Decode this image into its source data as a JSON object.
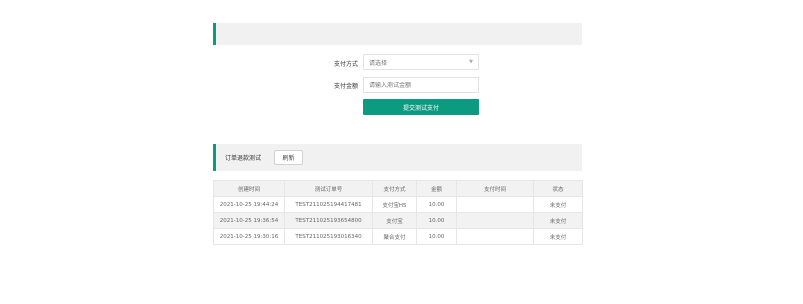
{
  "pay_form": {
    "method_label": "支付方式",
    "method_value": "请选择",
    "amount_label": "支付金额",
    "amount_placeholder": "请输入测试金额",
    "submit_label": "提交测试支付"
  },
  "order_section": {
    "title": "订单退款测试",
    "refresh_label": "刷新"
  },
  "table": {
    "headers": [
      "创建时间",
      "测试订单号",
      "支付方式",
      "金额",
      "支付时间",
      "状态"
    ],
    "rows": [
      [
        "2021-10-25 19:44:24",
        "TEST211025194417481",
        "支付宝H5",
        "10.00",
        "",
        "未支付"
      ],
      [
        "2021-10-25 19:36:54",
        "TEST211025193654800",
        "支付宝",
        "10.00",
        "",
        "未支付"
      ],
      [
        "2021-10-25 19:30:16",
        "TEST211025193016340",
        "聚合支付",
        "10.00",
        "",
        "未支付"
      ]
    ]
  },
  "colors": {
    "accent": "#0c9b80",
    "panel_bg": "#f1f1f1"
  },
  "icons": {
    "select_arrow": "chevron-down-icon"
  }
}
